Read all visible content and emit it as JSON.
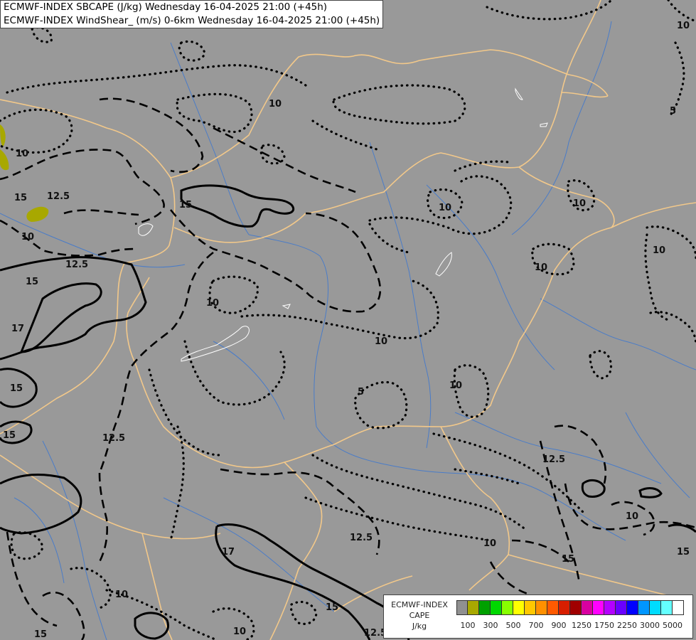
{
  "header": {
    "line1": "ECMWF-INDEX SBCAPE (J/kg) Wednesday 16-04-2025 21:00 (+45h)",
    "line2": "ECMWF-INDEX WindShear_ (m/s) 0-6km Wednesday 16-04-2025 21:00 (+45h)"
  },
  "legend": {
    "model": "ECMWF-INDEX",
    "variable": "CAPE",
    "unit": "J/kg",
    "colors": [
      "#909090",
      "#a8a800",
      "#00a000",
      "#00d800",
      "#88ff00",
      "#ffff00",
      "#ffc800",
      "#ff9000",
      "#ff5a00",
      "#d81e00",
      "#a00000",
      "#d800a0",
      "#ff00ff",
      "#b400ff",
      "#6a00ff",
      "#0000ff",
      "#0096ff",
      "#00dcff",
      "#64ffff",
      "#ffffff"
    ],
    "ticks": [
      "100",
      "300",
      "500",
      "700",
      "900",
      "1250",
      "1750",
      "2250",
      "3000",
      "5000"
    ]
  },
  "contour_labels": [
    {
      "text": "10"
    },
    {
      "text": "10"
    },
    {
      "text": "15"
    },
    {
      "text": "12.5"
    },
    {
      "text": "10"
    },
    {
      "text": "15"
    },
    {
      "text": "12.5"
    },
    {
      "text": "15"
    },
    {
      "text": "17"
    },
    {
      "text": "10"
    },
    {
      "text": "10"
    },
    {
      "text": "10"
    },
    {
      "text": "10"
    },
    {
      "text": "5"
    },
    {
      "text": "10"
    },
    {
      "text": "5"
    },
    {
      "text": "15"
    },
    {
      "text": "15"
    },
    {
      "text": "12.5"
    },
    {
      "text": "12.5"
    },
    {
      "text": "10"
    },
    {
      "text": "10"
    },
    {
      "text": "12.5"
    },
    {
      "text": "17"
    },
    {
      "text": "10"
    },
    {
      "text": "10"
    },
    {
      "text": "15"
    },
    {
      "text": "15"
    },
    {
      "text": "12.5"
    },
    {
      "text": "10"
    },
    {
      "text": "15"
    },
    {
      "text": "15"
    },
    {
      "text": "10"
    },
    {
      "text": "10"
    }
  ]
}
